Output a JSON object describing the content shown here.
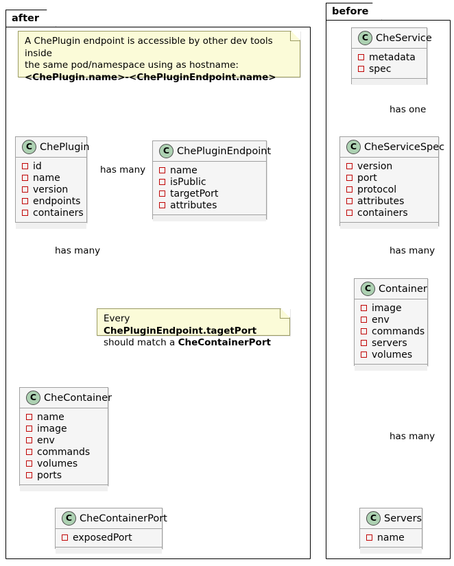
{
  "diagram": {
    "type": "uml-class-diagram",
    "packages": [
      {
        "id": "after",
        "label": "after"
      },
      {
        "id": "before",
        "label": "before"
      }
    ]
  },
  "colors": {
    "class_fill": "#F5F5F5",
    "class_border": "#A0A0A0",
    "class_icon_fill": "#ADD1B2",
    "attr_marker": "#C00000",
    "note_fill": "#FBFBD8",
    "note_border": "#9A9A62",
    "frame_border": "#000000",
    "link": "#181818"
  },
  "icons": {
    "class_letter": "C"
  },
  "after": {
    "title": "after",
    "classes": [
      {
        "id": "cheplugin",
        "name": "ChePlugin",
        "attributes": [
          "id",
          "name",
          "version",
          "endpoints",
          "containers"
        ]
      },
      {
        "id": "chepluginendpoint",
        "name": "ChePluginEndpoint",
        "attributes": [
          "name",
          "isPublic",
          "targetPort",
          "attributes"
        ]
      },
      {
        "id": "checontainer",
        "name": "CheContainer",
        "attributes": [
          "name",
          "image",
          "env",
          "commands",
          "volumes",
          "ports"
        ]
      },
      {
        "id": "checontainerport",
        "name": "CheContainerPort",
        "attributes": [
          "exposedPort"
        ]
      }
    ],
    "notes": [
      {
        "id": "note-hostname",
        "lines": [
          {
            "text": "A ChePlugin endpoint is accessible by other dev tools inside",
            "bold": false
          },
          {
            "text": "the same pod/namespace using as hostname:",
            "bold": false
          },
          {
            "text": "<ChePlugin.name>-<ChePluginEndpoint.name>",
            "bold": true
          }
        ]
      },
      {
        "id": "note-targetport",
        "segments_line1": [
          {
            "text": "Every ",
            "bold": false
          },
          {
            "text": "ChePluginEndpoint.tagetPort",
            "bold": true
          }
        ],
        "segments_line2": [
          {
            "text": "should match a ",
            "bold": false
          },
          {
            "text": "CheContainerPort",
            "bold": true
          }
        ]
      }
    ],
    "relations": [
      {
        "id": "rel-plugin-endpoint",
        "from": "ChePlugin",
        "to": "ChePluginEndpoint",
        "label": "has many",
        "kind": "composition"
      },
      {
        "id": "rel-plugin-container",
        "from": "ChePlugin",
        "to": "CheContainer",
        "label": "has many",
        "kind": "composition"
      },
      {
        "id": "rel-container-port",
        "from": "CheContainer",
        "to": "CheContainerPort",
        "label": "",
        "kind": "composition"
      },
      {
        "id": "rel-endpoint-port",
        "from": "ChePluginEndpoint",
        "to": "CheContainerPort",
        "label": "",
        "kind": "dashed"
      }
    ]
  },
  "before": {
    "title": "before",
    "classes": [
      {
        "id": "cheservice",
        "name": "CheService",
        "attributes": [
          "metadata",
          "spec"
        ]
      },
      {
        "id": "cheservicespec",
        "name": "CheServiceSpec",
        "attributes": [
          "version",
          "port",
          "protocol",
          "attributes",
          "containers"
        ]
      },
      {
        "id": "container",
        "name": "Container",
        "attributes": [
          "image",
          "env",
          "commands",
          "servers",
          "volumes"
        ]
      },
      {
        "id": "servers",
        "name": "Servers",
        "attributes": [
          "name"
        ]
      }
    ],
    "relations": [
      {
        "id": "rel-service-spec",
        "from": "CheService",
        "to": "CheServiceSpec",
        "label": "has one",
        "kind": "aggregation"
      },
      {
        "id": "rel-spec-container",
        "from": "CheServiceSpec",
        "to": "Container",
        "label": "has many",
        "kind": "composition"
      },
      {
        "id": "rel-container-servers",
        "from": "Container",
        "to": "Servers",
        "label": "has many",
        "kind": "composition"
      }
    ]
  }
}
